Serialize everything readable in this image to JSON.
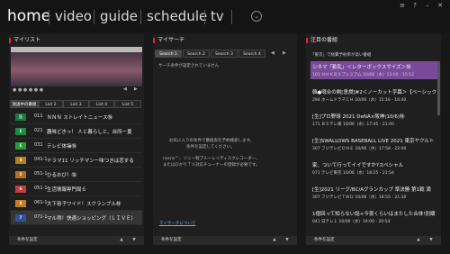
{
  "nav": {
    "items": [
      "home",
      "video",
      "guide",
      "schedule",
      "tv"
    ],
    "more": "⌄"
  },
  "window": {
    "icons": [
      "≡",
      "?",
      "–",
      "✕"
    ]
  },
  "mylist": {
    "title": "マイリスト",
    "tabs": [
      "放送中の番組",
      "List 2",
      "List 3",
      "List 4",
      "List 5"
    ],
    "active_tab": 0,
    "channels": [
      {
        "num": "011",
        "text": "ＮＮＮ ストレイトニュース㊕",
        "logo_color": "#1a7a3a",
        "logo": "日"
      },
      {
        "num": "021",
        "text": "趣味どきっ！ 人と暮らしと、台所ー夏",
        "logo_color": "#1f8a40",
        "logo": "E"
      },
      {
        "num": "031",
        "text": "テレビ体操㊕",
        "logo_color": "#2a9a3a",
        "logo": "E"
      },
      {
        "num": "041-1",
        "text": "ドラマ11 リッチマン一味つきは恋する",
        "logo_color": "#b08020",
        "logo": "4"
      },
      {
        "num": "051-1",
        "text": "ひるおび！㊕",
        "logo_color": "#b07020",
        "logo": "5"
      },
      {
        "num": "051-1",
        "text": "生活情報専門局６",
        "logo_color": "#c04040",
        "logo": "6"
      },
      {
        "num": "061-1",
        "text": "大下容子ワイド！スクランブル㊕",
        "logo_color": "#c08020",
        "logo": "8"
      },
      {
        "num": "071-1",
        "text": "マル得！快適ショッピング（ＬＩＶＥ）",
        "logo_color": "#3050a0",
        "logo": "7"
      }
    ],
    "footer": "条件を設定"
  },
  "mysearch": {
    "title": "マイサーチ",
    "tabs": [
      "Search 1",
      "Search 2",
      "Search 3",
      "Search 4"
    ],
    "active_tab": 0,
    "empty": "サーチ条件が設定されていません",
    "hint1": "お気に入りの条件で番組表を予約検索します。",
    "hint2": "条件を設定してください。",
    "hint3": "nasne™、ソニー製ブルーレイディスクレコーダー、",
    "hint4": "またはひかりＴＶ対応チューナーの登録が必要です。",
    "link": "マイサーチについて",
    "footer": "条件を設定"
  },
  "featured": {
    "title": "注目の番組",
    "items": [
      {
        "title": "「東京」で経費予約率が高い番組",
        "meta": ""
      },
      {
        "title": "シネマ「勤乱」＜レターボックスサイズ＞㊕",
        "meta": "103 ＮＨＫＢＳプレミアム 10/06（水）13:00 - 15:12"
      },
      {
        "title": "韓●噂合の剣[意燃]#2＜ノーカット字幕＞【ベーシック",
        "meta": "294 ホームドラマＣＨ 10/06（水）15:16 - 16:40"
      },
      {
        "title": "[生]プロ野球 2021 DeNA×阪神(10/6)㊕",
        "meta": "171 ＢＳテレ東 10/06（水）17:45 - 21:00"
      },
      {
        "title": "[生]SWALLOWS BASEBALL LIVE 2021 東京ヤクルト",
        "meta": "307 フジテレビＯＮＥ 10/06（水）17:58 - 22:00"
      },
      {
        "title": "家、ついて行ってイイですか?スペシャル",
        "meta": "071 テレビ東京 10/06（水）18:25 - 21:54"
      },
      {
        "title": "[生]2021 リーグ/BC/Aグランカップ 準決勝 第1戦 満",
        "meta": "307 フジテレビＴＷＯ 10/06（水）18:55 - 21:30"
      },
      {
        "title": "1億回って知らない話+今夜くらいはまたした合体!別嬢",
        "meta": "041 日テレ１ 10/06（水）19:00 - 20:54"
      }
    ],
    "footer": "条件を設定"
  },
  "player": {
    "dots": "● ● ● ● ● ●",
    "prev": "◀",
    "next": "▶"
  },
  "footer_arrows": {
    "up": "▲",
    "down": "▼"
  }
}
